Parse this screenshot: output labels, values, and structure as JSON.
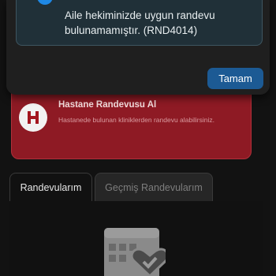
{
  "dialog": {
    "message": "Aile hekiminizde uygun randevu bulunamamıştır. (RND4014)",
    "ok_label": "Tamam"
  },
  "hospital_card": {
    "title": "Hastane Randevusu Al",
    "subtitle": "Hastanede bulunan kliniklerden randevu alabilirsiniz.",
    "logo_letter": "H"
  },
  "tabs": [
    {
      "label": "Randevularım",
      "active": true
    },
    {
      "label": "Geçmiş Randevularım",
      "active": false
    }
  ],
  "empty_state": {
    "icon": "calendar-heart-icon"
  },
  "colors": {
    "accent": "#1c5a94",
    "info": "#1e88e5",
    "hospital_red": "#8e1a24"
  }
}
